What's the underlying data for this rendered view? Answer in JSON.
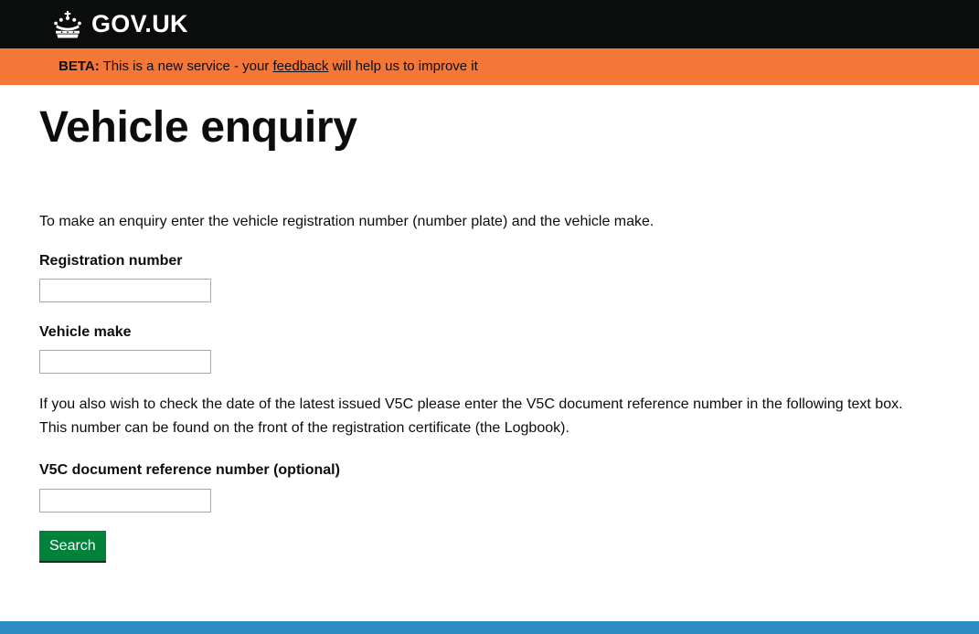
{
  "header": {
    "crown_icon": "crown-icon",
    "logotype": "GOV.UK"
  },
  "phase_banner": {
    "tag": "BETA:",
    "text_before_link": " This is a new service - your ",
    "link_label": "feedback",
    "text_after_link": " will help us to improve it"
  },
  "page": {
    "title": "Vehicle enquiry",
    "intro": "To make an enquiry enter the vehicle registration number (number plate) and the vehicle make.",
    "helper": "If you also wish to check the date of the latest issued V5C please enter the V5C document reference number in the following text box. This number can be found on the front of the registration certificate (the Logbook)."
  },
  "form": {
    "registration_number": {
      "label": "Registration number",
      "value": "",
      "placeholder": ""
    },
    "vehicle_make": {
      "label": "Vehicle make",
      "value": "",
      "placeholder": ""
    },
    "v5c_reference": {
      "label": "V5C document reference number (optional)",
      "value": "",
      "placeholder": ""
    },
    "submit_label": "Search"
  },
  "colors": {
    "header_background": "#0b0c0c",
    "phase_banner_background": "#f47738",
    "button_green": "#00823b",
    "footer_blue": "#2b8cc4",
    "input_border": "#a8a8a8",
    "text": "#0b0c0c"
  }
}
